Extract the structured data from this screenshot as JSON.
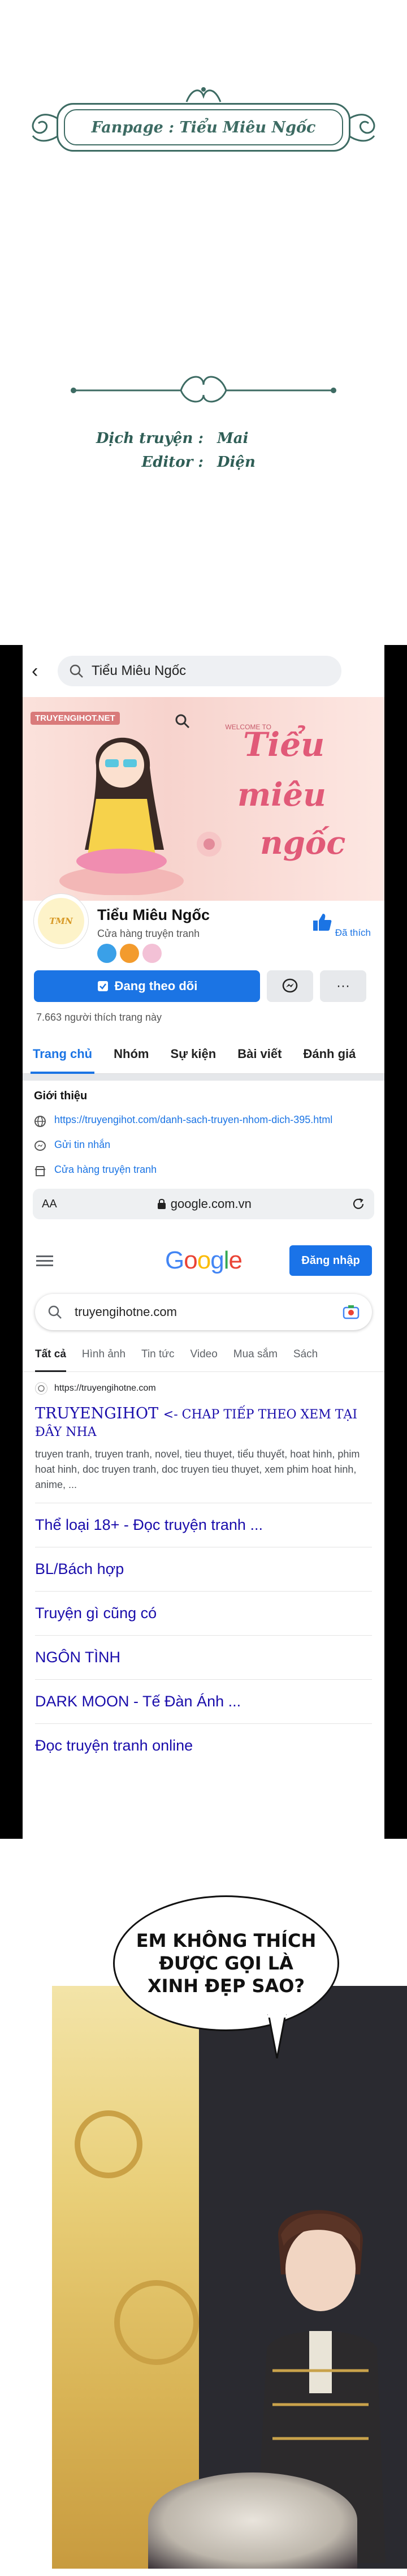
{
  "banner": {
    "text": "Fanpage : Tiểu Miêu Ngốc"
  },
  "credits": {
    "translator_label": "Dịch truyện :",
    "translator": "Mai",
    "editor_label": "Editor :",
    "editor": "Diện"
  },
  "facebook": {
    "search_text": "Tiểu Miêu Ngốc",
    "cover": {
      "tag": "TRUYENGIHOT.NET",
      "welcome": "WELCOME TO",
      "script_line1": "Tiểu",
      "script_line2": "miêu",
      "script_line3": "ngốc"
    },
    "page_name": "Tiểu Miêu Ngốc",
    "page_category": "Cửa hàng truyện tranh",
    "like_label": "Đã thích",
    "follow_label": "Đang theo dõi",
    "more_label": "···",
    "likes_count": "7.663 người thích trang này",
    "tabs": [
      "Trang chủ",
      "Nhóm",
      "Sự kiện",
      "Bài viết",
      "Đánh giá"
    ],
    "intro_title": "Giới thiệu",
    "intro_link": "https://truyengihot.com/danh-sach-truyen-nhom-dich-395.html",
    "intro_message": "Gửi tin nhắn",
    "intro_shop": "Cửa hàng truyện tranh"
  },
  "browser": {
    "aa": "AA",
    "host": "google.com.vn"
  },
  "google": {
    "logo": "Google",
    "signin_label": "Đăng nhập",
    "query": "truyengihotne.com",
    "tabs": [
      "Tất cả",
      "Hình ảnh",
      "Tin tức",
      "Video",
      "Mua sắm",
      "Sách"
    ],
    "result_url": "https://truyengihotne.com",
    "result_title": "TRUYENGIHOT",
    "result_title_tail": "<- CHAP TIẾP THEO XEM TẠI ĐÂY NHA",
    "result_snippet": "truyen tranh, truyen tranh, novel, tieu thuyet, tiểu thuyết, hoat hinh, phim hoat hinh, doc truyen tranh, doc truyen tieu thuyet, xem phim hoat hinh, anime, ...",
    "sitelinks": [
      "Thể loại 18+ - Đọc truyện tranh ...",
      "BL/Bách hợp",
      "Truyện gì cũng có",
      "NGÔN TÌNH",
      "DARK MOON - Tế Đàn Ánh ...",
      "Đọc truyện tranh online"
    ]
  },
  "comic": {
    "bubble_text": "EM KHÔNG THÍCH ĐƯỢC GỌI LÀ XINH ĐẸP SAO?"
  },
  "colors": {
    "banner_green": "#3d6b63",
    "facebook_blue": "#1b74e4",
    "google_link": "#1a0dab"
  }
}
